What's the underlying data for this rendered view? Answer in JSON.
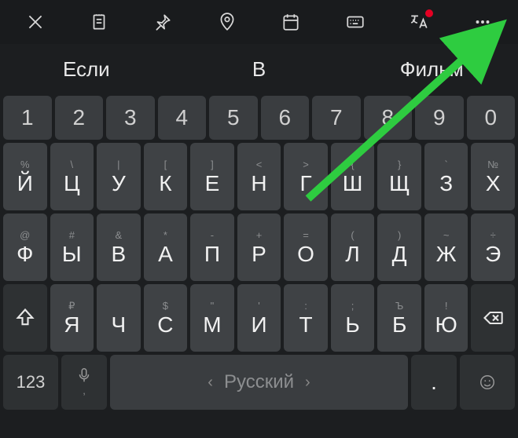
{
  "toolbar": {
    "close": "close",
    "note": "note",
    "pin": "pin",
    "location": "location",
    "calendar": "calendar",
    "keyboard": "keyboard",
    "translate": "translate",
    "more": "more"
  },
  "suggestions": [
    "Если",
    "В",
    "Фильм"
  ],
  "rows": {
    "numbers": [
      "1",
      "2",
      "3",
      "4",
      "5",
      "6",
      "7",
      "8",
      "9",
      "0"
    ],
    "row2": [
      {
        "hint": "%",
        "main": "Й"
      },
      {
        "hint": "\\",
        "main": "Ц"
      },
      {
        "hint": "|",
        "main": "У"
      },
      {
        "hint": "[",
        "main": "К"
      },
      {
        "hint": "]",
        "main": "Е"
      },
      {
        "hint": "<",
        "main": "Н"
      },
      {
        "hint": ">",
        "main": "Г"
      },
      {
        "hint": "{",
        "main": "Ш"
      },
      {
        "hint": "}",
        "main": "Щ"
      },
      {
        "hint": "`",
        "main": "З"
      },
      {
        "hint": "№",
        "main": "Х"
      }
    ],
    "row3": [
      {
        "hint": "@",
        "main": "Ф"
      },
      {
        "hint": "#",
        "main": "Ы"
      },
      {
        "hint": "&",
        "main": "В"
      },
      {
        "hint": "*",
        "main": "А"
      },
      {
        "hint": "-",
        "main": "П"
      },
      {
        "hint": "+",
        "main": "Р"
      },
      {
        "hint": "=",
        "main": "О"
      },
      {
        "hint": "(",
        "main": "Л"
      },
      {
        "hint": ")",
        "main": "Д"
      },
      {
        "hint": "~",
        "main": "Ж"
      },
      {
        "hint": "÷",
        "main": "Э"
      }
    ],
    "row4": [
      {
        "hint": "₽",
        "main": "Я"
      },
      {
        "hint": "",
        "main": "Ч"
      },
      {
        "hint": "$",
        "main": "С"
      },
      {
        "hint": "\"",
        "main": "М"
      },
      {
        "hint": "'",
        "main": "И"
      },
      {
        "hint": ":",
        "main": "Т"
      },
      {
        "hint": ";",
        "main": "Ь"
      },
      {
        "hint": "Ъ",
        "main": "Б"
      },
      {
        "hint": "!",
        "main": "Ю"
      }
    ]
  },
  "bottom": {
    "sym": "123",
    "space_label": "Русский"
  }
}
